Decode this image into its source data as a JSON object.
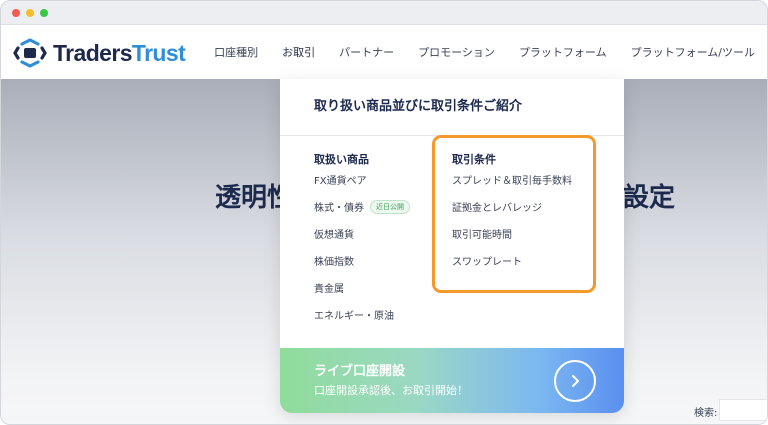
{
  "brand": {
    "name_part1": "Traders",
    "name_part2": "Trust",
    "color_dark": "#1e2a4a",
    "color_accent": "#2e8fd6"
  },
  "nav": {
    "items": [
      "口座種別",
      "お取引",
      "パートナー",
      "プロモーション",
      "プラットフォーム",
      "プラットフォーム/ツール"
    ]
  },
  "hero": {
    "title_left": "透明性",
    "title_right": "設定"
  },
  "mega_menu": {
    "title": "取り扱い商品並びに取引条件ご紹介",
    "left_column": {
      "heading": "取扱い商品",
      "items": [
        "FX通貨ペア",
        "株式・債券",
        "仮想通貨",
        "株価指数",
        "貴金属",
        "エネルギー・原油"
      ],
      "badge": "近日公開"
    },
    "right_column": {
      "heading": "取引条件",
      "items": [
        "スプレッド＆取引毎手数料",
        "証拠金とレバレッジ",
        "取引可能時間",
        "スワップレート"
      ]
    },
    "highlight_color": "#f39a2b",
    "cta": {
      "title": "ライブ口座開設",
      "subtitle": "口座開設承認後、お取引開始！",
      "icon": "chevron-right-icon"
    }
  },
  "search": {
    "label": "検索:"
  }
}
